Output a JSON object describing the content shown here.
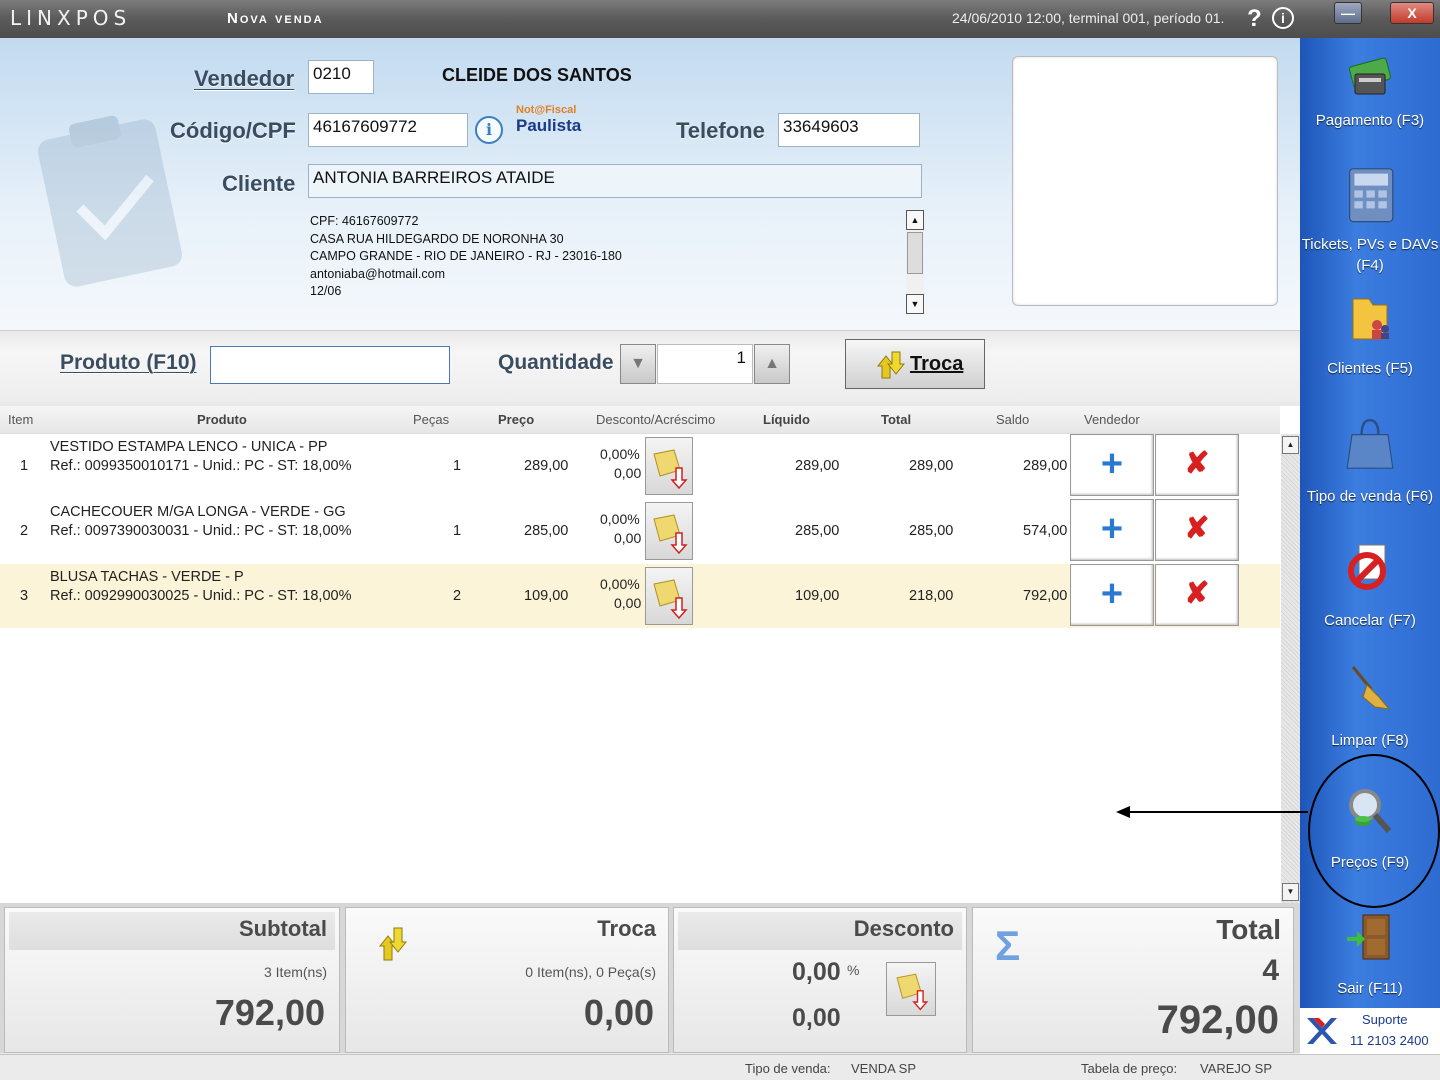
{
  "titlebar": {
    "logo": "LINXPOS",
    "title": "Nova venda",
    "status": "24/06/2010 12:00, terminal 001, período 01.",
    "help": "?",
    "info": "i",
    "min": "—",
    "close": "X"
  },
  "header": {
    "vendedor_label": "Vendedor",
    "vendedor_code": "0210",
    "vendedor_name": "CLEIDE DOS SANTOS",
    "codigo_label": "Código/CPF",
    "codigo_value": "46167609772",
    "nfp_line1a": "Not@",
    "nfp_line1b": "Fiscal",
    "nfp_line2": "Paulista",
    "telefone_label": "Telefone",
    "telefone_value": "33649603",
    "cliente_label": "Cliente",
    "cliente_value": "ANTONIA BARREIROS ATAIDE",
    "address_lines": [
      "CPF: 46167609772",
      "CASA RUA HILDEGARDO DE NORONHA 30",
      "CAMPO GRANDE - RIO DE JANEIRO - RJ - 23016-180",
      "antoniaba@hotmail.com",
      "12/06"
    ]
  },
  "product_bar": {
    "produto_label": "Produto (F10)",
    "produto_value": "",
    "quantidade_label": "Quantidade",
    "quantidade_value": "1",
    "troca_label": "Troca"
  },
  "table": {
    "headers": {
      "item": "Item",
      "produto": "Produto",
      "pecas": "Peças",
      "preco": "Preço",
      "desconto": "Desconto/Acréscimo",
      "liquido": "Líquido",
      "total": "Total",
      "saldo": "Saldo",
      "vendedor": "Vendedor"
    },
    "rows": [
      {
        "item": "1",
        "name": "VESTIDO ESTAMPA LENCO - UNICA - PP",
        "ref": "Ref.: 0099350010171 - Unid.: PC - ST: 18,00%",
        "pecas": "1",
        "preco": "289,00",
        "desc_pct": "0,00%",
        "desc_val": "0,00",
        "liquido": "289,00",
        "total": "289,00",
        "saldo": "289,00"
      },
      {
        "item": "2",
        "name": "CACHECOUER M/GA LONGA - VERDE - GG",
        "ref": "Ref.: 0097390030031 - Unid.: PC - ST: 18,00%",
        "pecas": "1",
        "preco": "285,00",
        "desc_pct": "0,00%",
        "desc_val": "0,00",
        "liquido": "285,00",
        "total": "285,00",
        "saldo": "574,00"
      },
      {
        "item": "3",
        "name": "BLUSA TACHAS - VERDE - P",
        "ref": "Ref.: 0092990030025 - Unid.: PC - ST: 18,00%",
        "pecas": "2",
        "preco": "109,00",
        "desc_pct": "0,00%",
        "desc_val": "0,00",
        "liquido": "109,00",
        "total": "218,00",
        "saldo": "792,00"
      }
    ],
    "plus_symbol": "+",
    "remove_symbol": "✘"
  },
  "totals": {
    "subtotal_label": "Subtotal",
    "subtotal_items": "3 Item(ns)",
    "subtotal_value": "792,00",
    "troca_label": "Troca",
    "troca_items": "0 Item(ns), 0 Peça(s)",
    "troca_value": "0,00",
    "desconto_label": "Desconto",
    "desconto_pct": "0,00",
    "desconto_pct_sign": "%",
    "desconto_value": "0,00",
    "total_label": "Total",
    "total_count": "4",
    "total_value": "792,00",
    "sigma": "Σ"
  },
  "sidebar": {
    "items": [
      {
        "label": "Pagamento (F3)",
        "icon": "money-icon"
      },
      {
        "label": "Tickets, PVs e DAVs (F4)",
        "icon": "calculator-icon"
      },
      {
        "label": "Clientes (F5)",
        "icon": "folder-users-icon"
      },
      {
        "label": "Tipo de venda (F6)",
        "icon": "shopping-bag-icon"
      },
      {
        "label": "Cancelar (F7)",
        "icon": "cancel-icon"
      },
      {
        "label": "Limpar (F8)",
        "icon": "broom-icon"
      },
      {
        "label": "Preços (F9)",
        "icon": "magnifier-icon"
      },
      {
        "label": "Sair (F11)",
        "icon": "exit-door-icon"
      }
    ],
    "support_title": "Suporte",
    "support_phone": "11 2103 2400"
  },
  "statusbar": {
    "tipo_label": "Tipo de venda:",
    "tipo_value": "VENDA SP",
    "tabela_label": "Tabela de preço:",
    "tabela_value": "VAREJO SP"
  },
  "colors": {
    "sidebar": "#2e6bd0",
    "header_bg": "#c2daf0",
    "selected_row": "#fcf4d8",
    "plus": "#2a78d0",
    "remove": "#d82020"
  }
}
